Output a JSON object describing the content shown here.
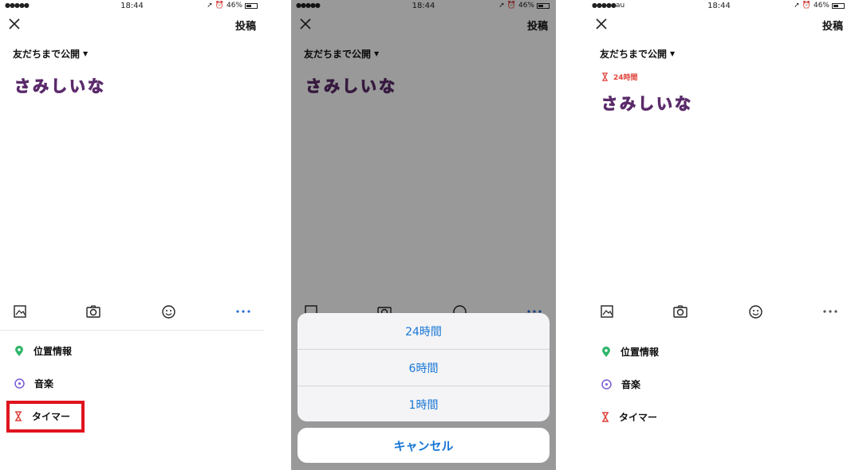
{
  "status": {
    "signal": "●●●●●",
    "carrier": "au",
    "time": "18:44",
    "battery": "46%"
  },
  "header": {
    "post_label": "投稿",
    "privacy_label": "友だちまで公開"
  },
  "post": {
    "stamp_text": "さみしいな"
  },
  "timer_badge": {
    "label": "24時間"
  },
  "menu": {
    "location": "位置情報",
    "music": "音楽",
    "timer": "タイマー"
  },
  "sheet": {
    "options": [
      "24時間",
      "6時間",
      "1時間"
    ],
    "cancel": "キャンセル"
  },
  "colors": {
    "accent_blue": "#1877d6",
    "timer_red": "#e0443c",
    "location_green": "#2fb56a",
    "music_purple": "#7a5ad6",
    "highlight": "#e0141e"
  }
}
